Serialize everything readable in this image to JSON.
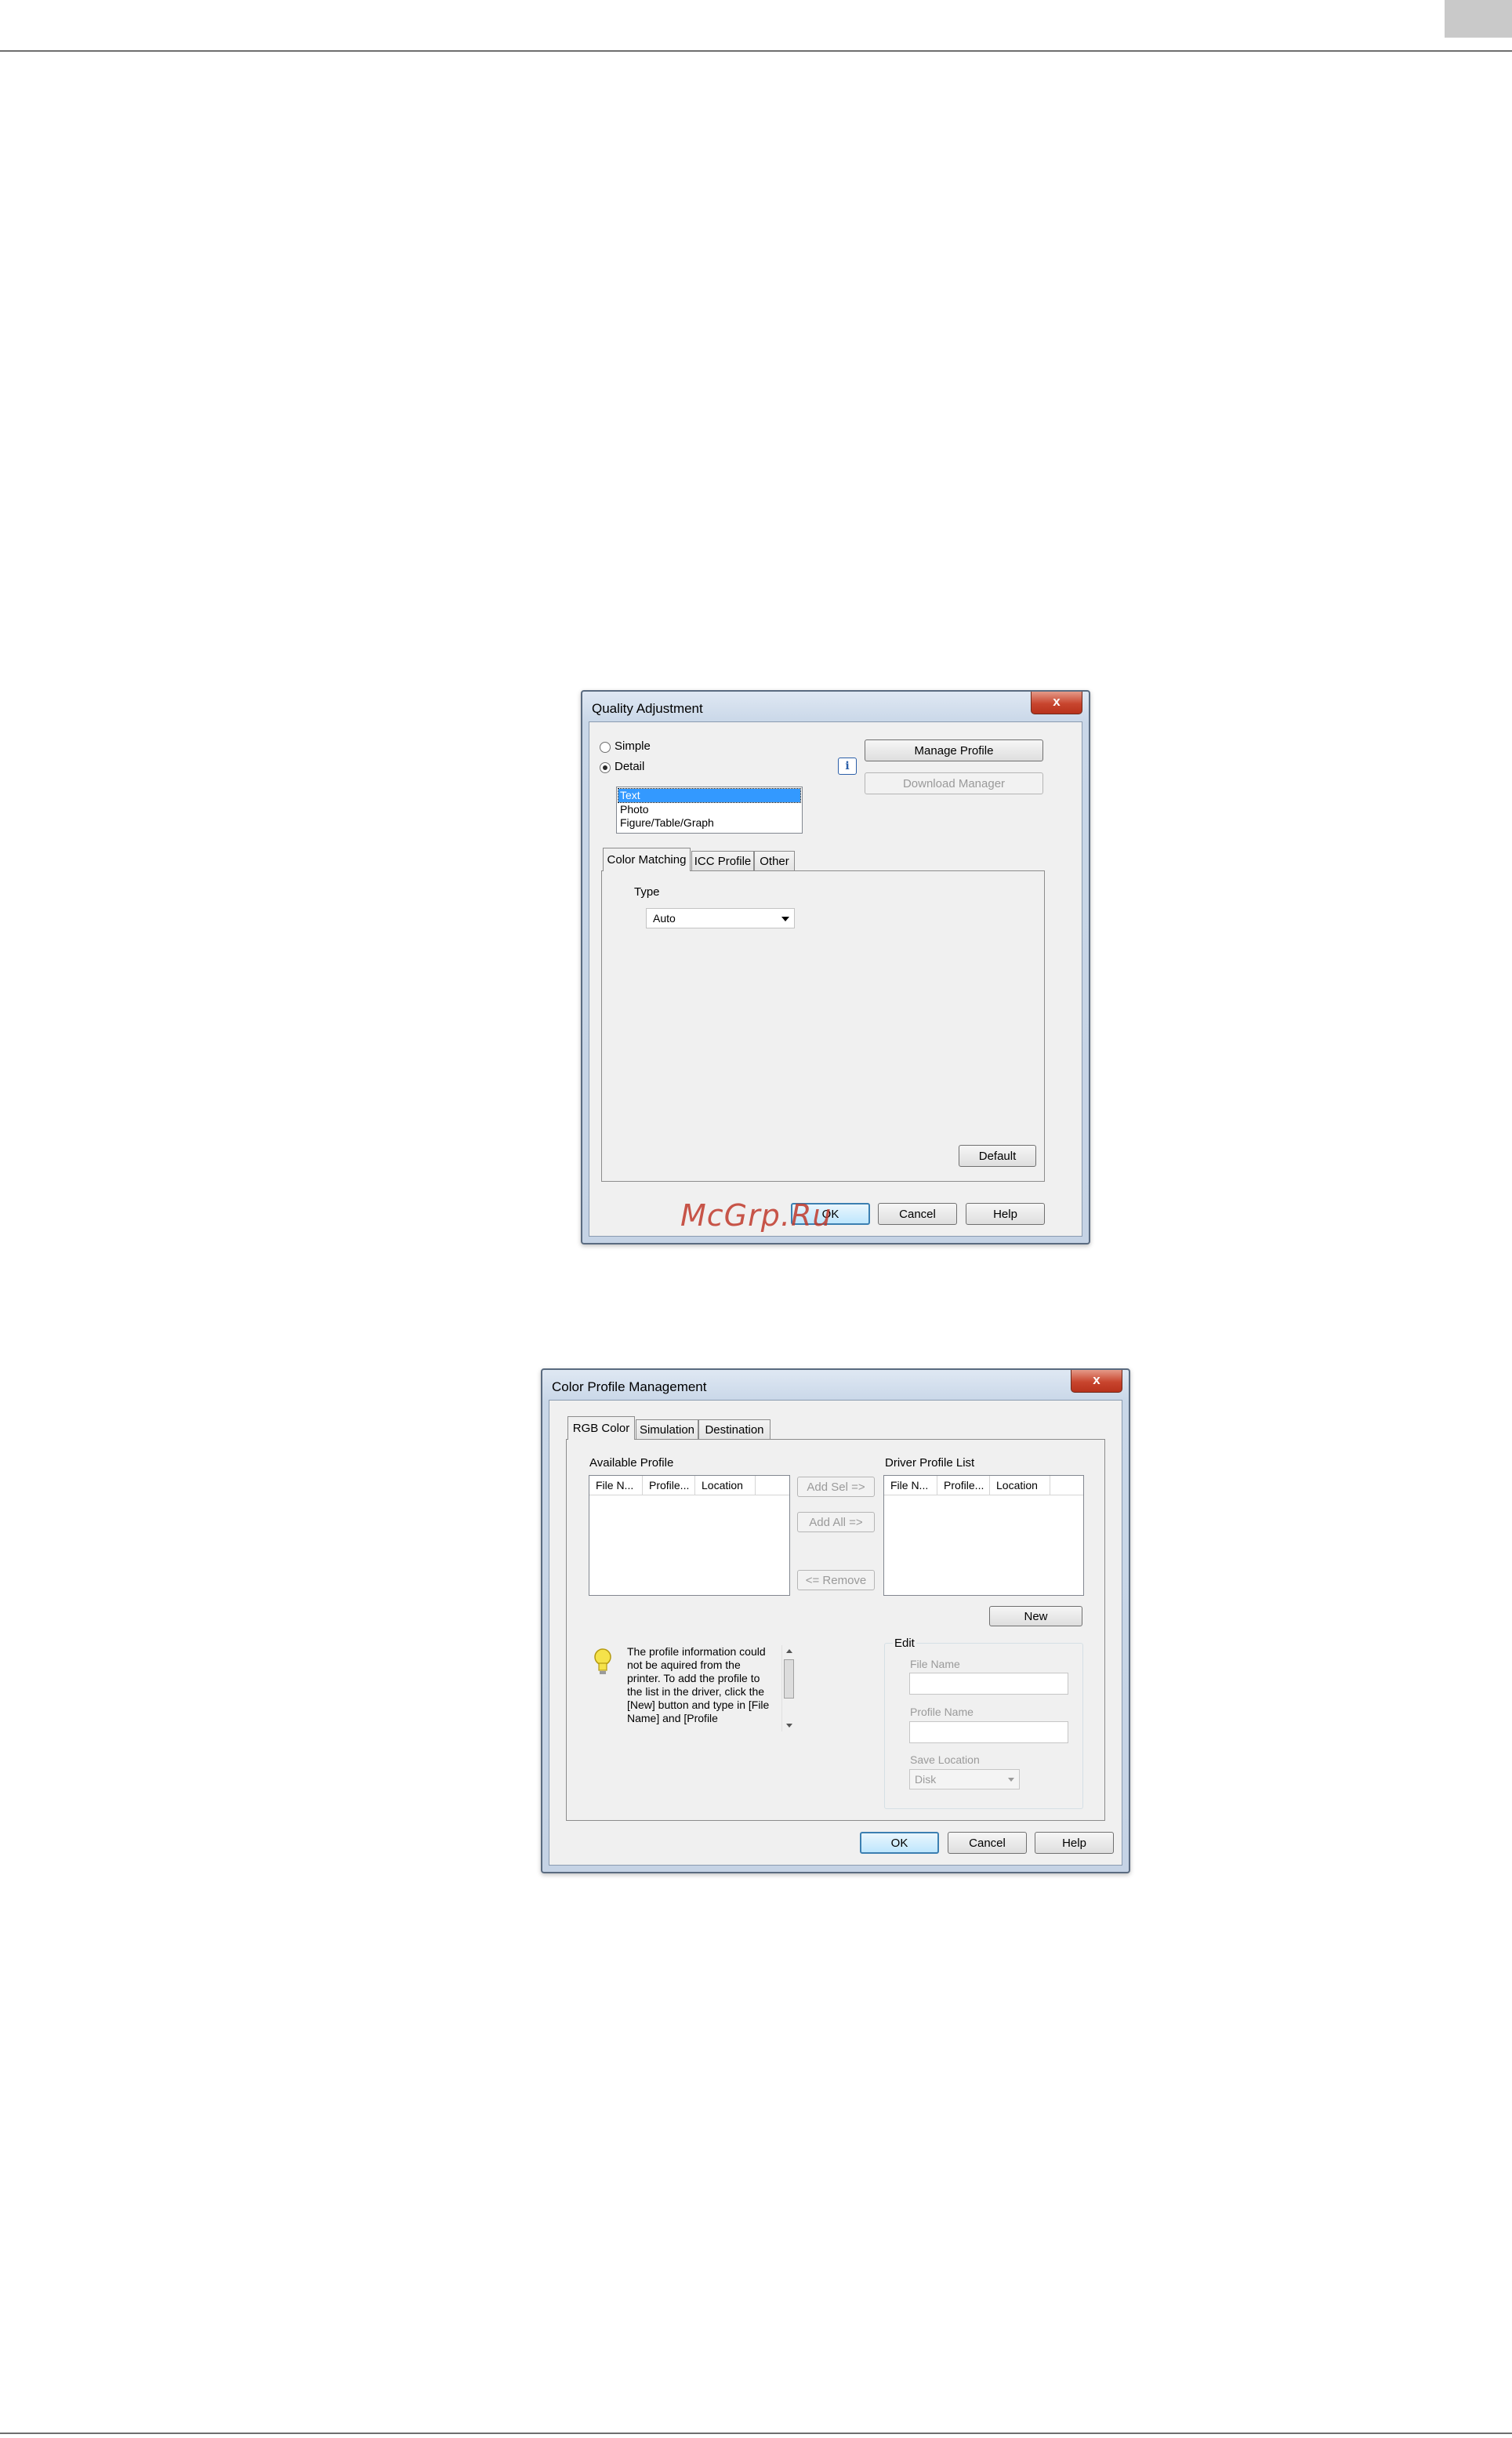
{
  "quality_dialog": {
    "title": "Quality Adjustment",
    "close_label": "x",
    "mode": {
      "simple_label": "Simple",
      "detail_label": "Detail",
      "selected": "Detail"
    },
    "object_list": [
      "Text",
      "Photo",
      "Figure/Table/Graph"
    ],
    "object_selected": "Text",
    "manage_profile_label": "Manage Profile",
    "download_manager_label": "Download Manager",
    "info_icon_glyph": "i",
    "tabs": [
      "Color Matching",
      "ICC Profile",
      "Other"
    ],
    "active_tab": "Color Matching",
    "type_label": "Type",
    "type_value": "Auto",
    "default_label": "Default",
    "ok_label": "OK",
    "cancel_label": "Cancel",
    "help_label": "Help"
  },
  "profile_dialog": {
    "title": "Color Profile Management",
    "close_label": "x",
    "tabs": [
      "RGB Color",
      "Simulation",
      "Destination"
    ],
    "active_tab": "RGB Color",
    "available_label": "Available Profile",
    "driver_label": "Driver Profile List",
    "columns": [
      "File N...",
      "Profile...",
      "Location"
    ],
    "add_sel_label": "Add Sel =>",
    "add_all_label": "Add All =>",
    "remove_label": "<= Remove",
    "new_label": "New",
    "info_text": "The profile information could not be aquired from the printer. To add the profile to the list in the driver, click the [New] button and type in [File Name] and [Profile",
    "edit_group_label": "Edit",
    "file_name_label": "File Name",
    "profile_name_label": "Profile Name",
    "save_location_label": "Save Location",
    "save_location_value": "Disk",
    "ok_label": "OK",
    "cancel_label": "Cancel",
    "help_label": "Help"
  },
  "watermark": "McGrp.Ru",
  "colors": {
    "title_bar": "#c9d7e8",
    "selection": "#3399ff",
    "close_button": "#c8452e",
    "watermark": "#c0392b"
  }
}
